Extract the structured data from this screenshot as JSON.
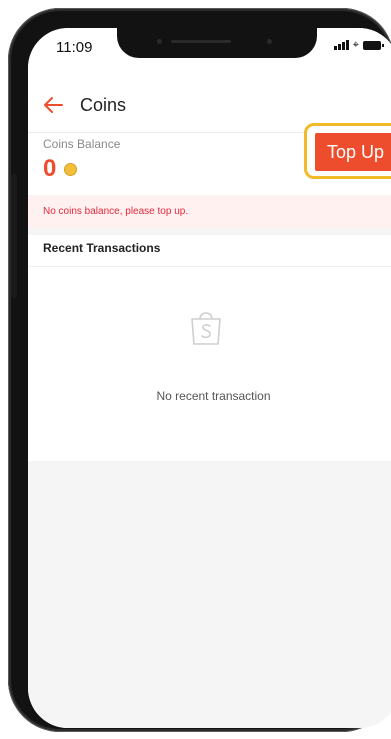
{
  "status_bar": {
    "time": "11:09"
  },
  "header": {
    "back_icon": "arrow-left-icon",
    "title": "Coins"
  },
  "balance": {
    "label": "Coins Balance",
    "value": "0",
    "coin_icon": "coin-icon",
    "top_up_label": "Top Up"
  },
  "notice": {
    "text": "No coins balance, please top up."
  },
  "recent": {
    "title": "Recent Transactions",
    "empty_icon": "shopping-bag-icon",
    "empty_text": "No recent transaction"
  },
  "colors": {
    "accent": "#ee4d2d",
    "highlight": "#f2b928",
    "warning_text": "#e6283c",
    "warning_bg": "#fff1f0"
  }
}
